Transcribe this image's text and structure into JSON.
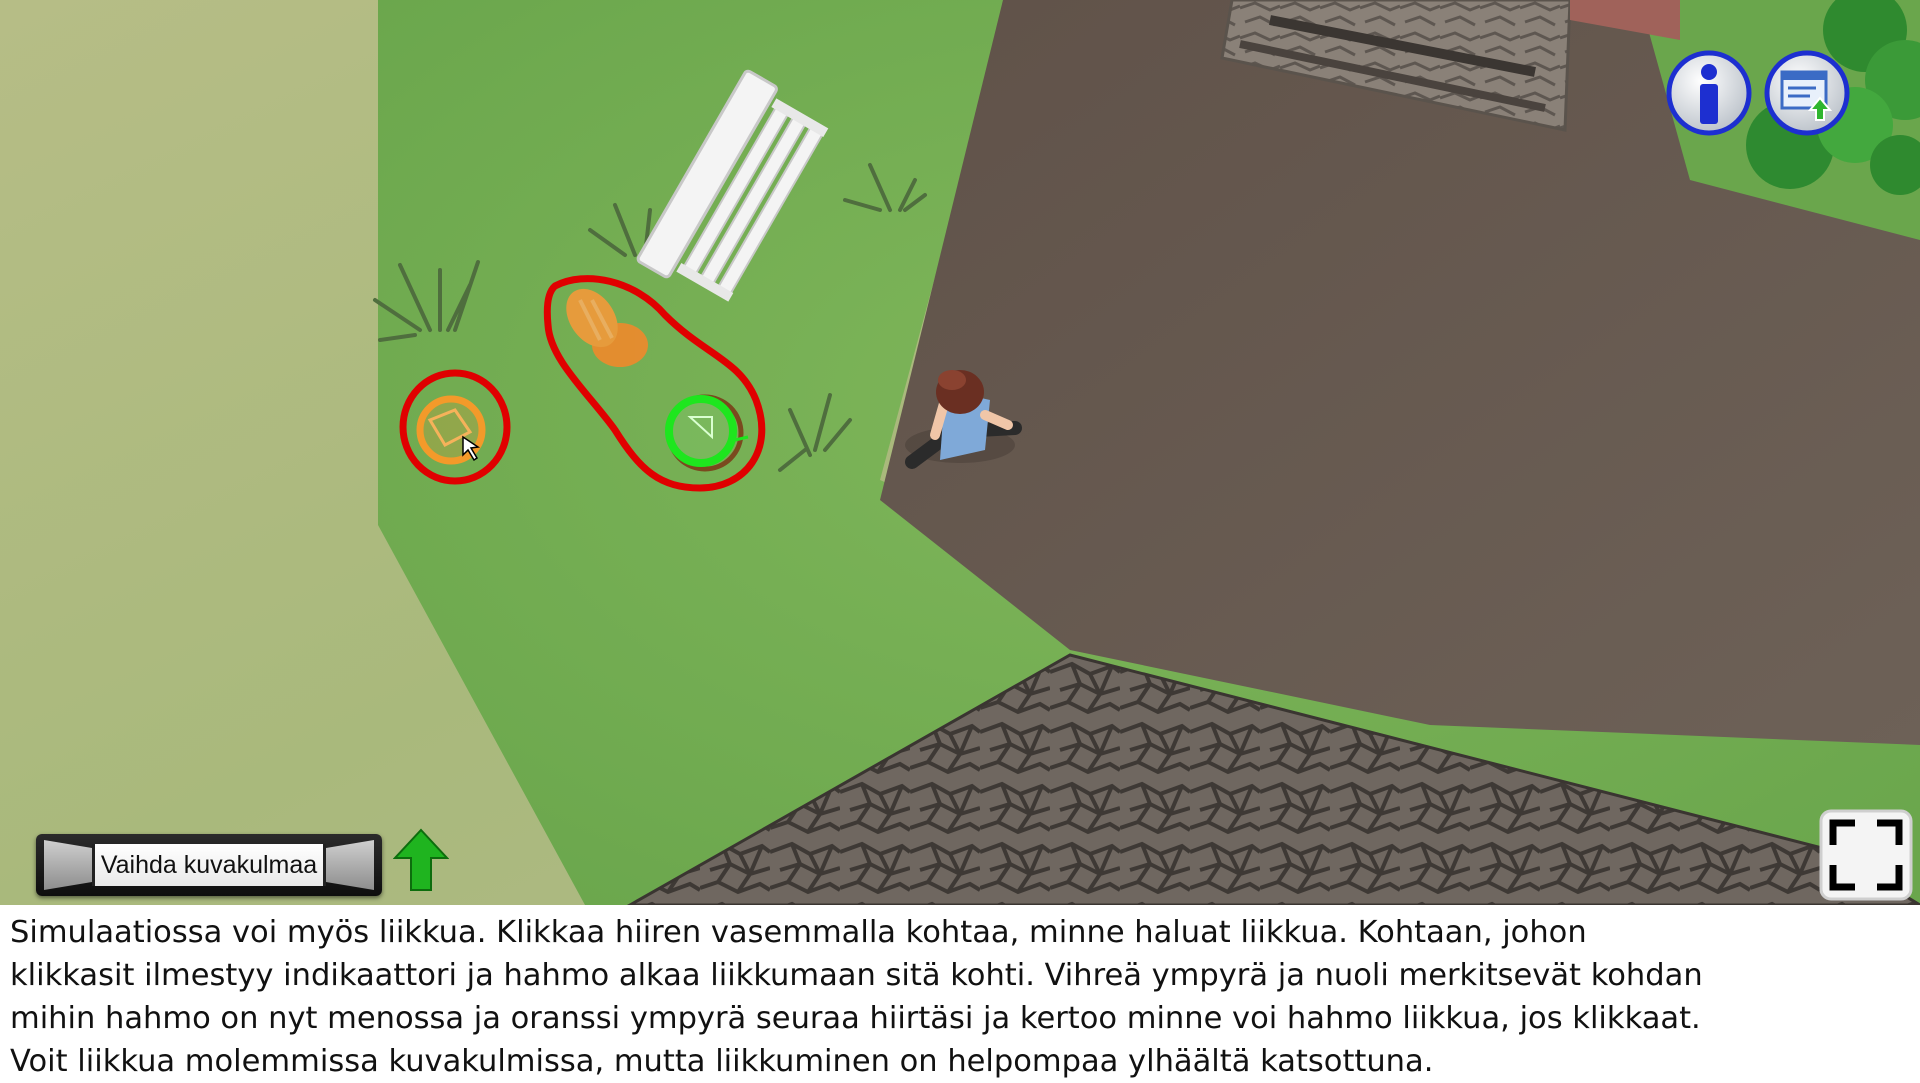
{
  "scene": {
    "description_icons": [
      "bench-icon",
      "character-icon",
      "bush-icon",
      "stairs-icon",
      "stone-roof-icon"
    ],
    "target_indicator": {
      "color": "#1ee61e",
      "label_icon": "green-target-circle-icon"
    },
    "hover_indicator": {
      "color": "#f39a2a",
      "label_icon": "orange-hover-circle-icon"
    },
    "highlight_color": "#e00000"
  },
  "hud": {
    "info_icon": "info-icon",
    "upload_icon": "upload-window-icon",
    "fullscreen_icon": "fullscreen-icon",
    "camera_button_label": "Vaihda kuvakulmaa",
    "arrow_icon": "green-up-arrow-icon",
    "accent_blue": "#1d2fd0",
    "arrow_green": "#1fb41f"
  },
  "instructions": {
    "lines": [
      "Simulaatiossa voi myös liikkua. Klikkaa hiiren vasemmalla kohtaa, minne haluat liikkua. Kohtaan, johon",
      "klikkasit ilmestyy indikaattori ja hahmo alkaa liikkumaan sitä kohti. Vihreä ympyrä ja nuoli merkitsevät kohdan",
      "mihin hahmo on nyt menossa ja oranssi ympyrä seuraa hiirtäsi ja kertoo minne voi hahmo liikkua, jos klikkaat.",
      "Voit liikkua molemmissa kuvakulmissa, mutta liikkuminen on helpompaa ylhäältä katsottuna."
    ]
  }
}
